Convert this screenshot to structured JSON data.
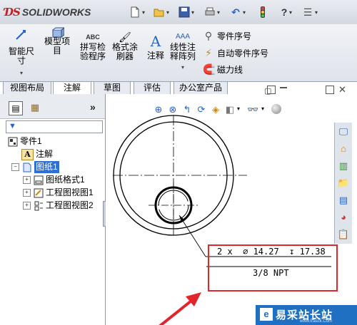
{
  "app": {
    "logo_mark": "ƊS",
    "logo_text": "SOLIDWORKS"
  },
  "quick_access": {
    "icons": [
      "new-document-icon",
      "open-icon",
      "save-icon",
      "print-icon",
      "undo-icon",
      "rebuild-icon",
      "help-icon",
      "options-icon"
    ]
  },
  "ribbon": {
    "smart_dimension": "智能尺寸",
    "model_items": "模型项目",
    "spell_checker": "拼写检验程序",
    "format_painter": "格式涂刷器",
    "note": "注释",
    "linear_note_pattern": "线性注释阵列",
    "balloon": "零件序号",
    "auto_balloon": "自动零件序号",
    "magnetic_line": "磁力线"
  },
  "tabs": [
    "视图布局",
    "注解",
    "草图",
    "评估",
    "办公室产品"
  ],
  "active_tab": "注解",
  "tree": {
    "part": "零件1",
    "annotations": "注解",
    "sheet": "图纸1",
    "sheet_format": "图纸格式1",
    "drawing_view1": "工程图视图1",
    "drawing_view2": "工程图视图2"
  },
  "panel": {
    "collapse_glyph": "»"
  },
  "hole_callout": {
    "line1": "2 x  ∅ 14.27  ↧ 17.38",
    "line2": "3/8 NPT"
  },
  "watermark": {
    "text": "易采站长站",
    "sub": "www.Easck.Com"
  },
  "colors": {
    "accent_red": "#e0262a",
    "selection_blue": "#2f6fd6",
    "watermark_blue": "#1f6fc2"
  }
}
